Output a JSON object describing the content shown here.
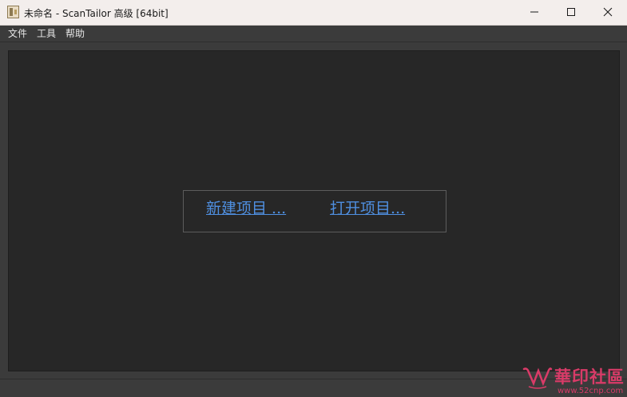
{
  "window": {
    "title": "未命名 - ScanTailor 高级 [64bit]",
    "icons": {
      "app": "scantailor-app-icon",
      "minimize": "minimize-icon",
      "maximize": "maximize-icon",
      "close": "close-icon"
    }
  },
  "menubar": {
    "items": [
      {
        "label": "文件"
      },
      {
        "label": "工具"
      },
      {
        "label": "帮助"
      }
    ]
  },
  "start_panel": {
    "new_project": "新建项目 ...",
    "open_project": "打开项目..."
  },
  "watermark": {
    "title": "華印社區",
    "url": "www.52cnp.com"
  },
  "colors": {
    "link": "#4f8fe0",
    "workspace_bg": "#272727",
    "chrome_bg": "#3b3b3b",
    "titlebar_bg": "#f3eeec",
    "watermark": "#d93b68"
  }
}
